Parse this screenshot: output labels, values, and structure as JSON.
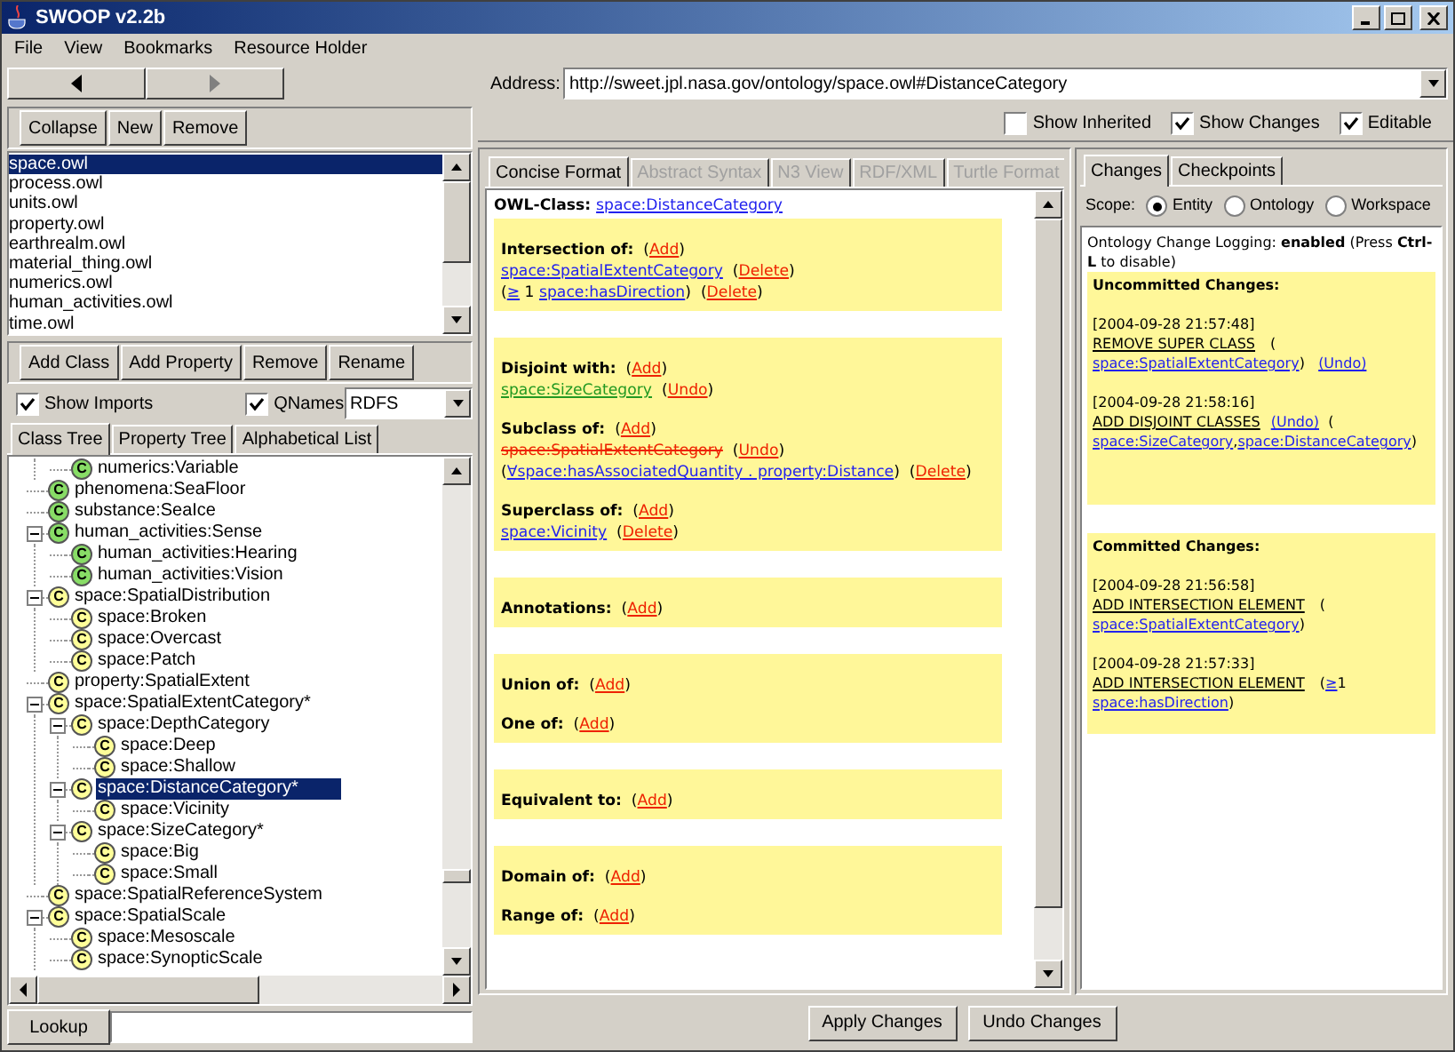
{
  "window": {
    "title": "SWOOP v2.2b"
  },
  "menu": [
    "File",
    "View",
    "Bookmarks",
    "Resource Holder"
  ],
  "address": {
    "label": "Address:",
    "value": "http://sweet.jpl.nasa.gov/ontology/space.owl#DistanceCategory"
  },
  "ontology_toolbar": [
    "Collapse",
    "New",
    "Remove"
  ],
  "ontologies": [
    {
      "name": "space.owl",
      "selected": true
    },
    {
      "name": "process.owl",
      "selected": false
    },
    {
      "name": "units.owl",
      "selected": false
    },
    {
      "name": "property.owl",
      "selected": false
    },
    {
      "name": "earthrealm.owl",
      "selected": false
    },
    {
      "name": "material_thing.owl",
      "selected": false
    },
    {
      "name": "numerics.owl",
      "selected": false
    },
    {
      "name": "human_activities.owl",
      "selected": false
    },
    {
      "name": "time.owl",
      "selected": false
    }
  ],
  "entity_toolbar": [
    "Add Class",
    "Add Property",
    "Remove",
    "Rename"
  ],
  "options": [
    {
      "label": "Show Imports",
      "checked": true
    },
    {
      "label": "QNames",
      "checked": true
    }
  ],
  "syntax_select": {
    "value": "RDFS"
  },
  "tree_tabs": [
    {
      "label": "Class Tree",
      "selected": true
    },
    {
      "label": "Property Tree",
      "selected": false
    },
    {
      "label": "Alphabetical List",
      "selected": false
    }
  ],
  "tree": [
    {
      "expanded": true,
      "children": [
        {
          "label": "numerics:Variable",
          "icon": "C",
          "color": "#88dd66",
          "selected": false
        }
      ]
    },
    {
      "label": "phenomena:SeaFloor",
      "icon": "C",
      "color": "#88dd66",
      "selected": false
    },
    {
      "label": "substance:SeaIce",
      "icon": "C",
      "color": "#88dd66",
      "selected": false
    },
    {
      "label": "human_activities:Sense",
      "icon": "C",
      "color": "#88dd66",
      "selected": false,
      "expanded": true,
      "children": [
        {
          "label": "human_activities:Hearing",
          "icon": "C",
          "color": "#88dd66",
          "selected": false
        },
        {
          "label": "human_activities:Vision",
          "icon": "C",
          "color": "#88dd66",
          "selected": false
        }
      ]
    },
    {
      "label": "space:SpatialDistribution",
      "icon": "C",
      "color": "#ffff99",
      "selected": false,
      "expanded": true,
      "children": [
        {
          "label": "space:Broken",
          "icon": "C",
          "color": "#ffff99",
          "selected": false
        },
        {
          "label": "space:Overcast",
          "icon": "C",
          "color": "#ffff99",
          "selected": false
        },
        {
          "label": "space:Patch",
          "icon": "C",
          "color": "#ffff99",
          "selected": false
        }
      ]
    },
    {
      "label": "property:SpatialExtent",
      "icon": "C",
      "color": "#ffff99",
      "selected": false
    },
    {
      "label": "space:SpatialExtentCategory*",
      "icon": "C",
      "color": "#ffff99",
      "selected": false,
      "expanded": true,
      "children": [
        {
          "label": "space:DepthCategory",
          "icon": "C",
          "color": "#ffff99",
          "selected": false,
          "expanded": true,
          "children": [
            {
              "label": "space:Deep",
              "icon": "C",
              "color": "#ffff99",
              "selected": false
            },
            {
              "label": "space:Shallow",
              "icon": "C",
              "color": "#ffff99",
              "selected": false
            }
          ]
        },
        {
          "label": "space:DistanceCategory*",
          "icon": "C",
          "color": "#ffff99",
          "selected": true,
          "expanded": true,
          "children": [
            {
              "label": "space:Vicinity",
              "icon": "C",
              "color": "#ffff99",
              "selected": false
            }
          ]
        },
        {
          "label": "space:SizeCategory*",
          "icon": "C",
          "color": "#ffff99",
          "selected": false,
          "expanded": true,
          "children": [
            {
              "label": "space:Big",
              "icon": "C",
              "color": "#ffff99",
              "selected": false
            },
            {
              "label": "space:Small",
              "icon": "C",
              "color": "#ffff99",
              "selected": false
            }
          ]
        }
      ]
    },
    {
      "label": "space:SpatialReferenceSystem",
      "icon": "C",
      "color": "#ffff99",
      "selected": false
    },
    {
      "label": "space:SpatialScale",
      "icon": "C",
      "color": "#ffff99",
      "selected": false,
      "expanded": true,
      "children": [
        {
          "label": "space:Mesoscale",
          "icon": "C",
          "color": "#ffff99",
          "selected": false
        },
        {
          "label": "space:SynopticScale",
          "icon": "C",
          "color": "#ffff99",
          "selected": false
        }
      ]
    }
  ],
  "lookup": {
    "button": "Lookup"
  },
  "view_options": [
    {
      "label": "Show Inherited",
      "checked": false
    },
    {
      "label": "Show Changes",
      "checked": true
    },
    {
      "label": "Editable",
      "checked": true
    }
  ],
  "format_tabs": [
    {
      "label": "Concise Format",
      "selected": true,
      "disabled": false
    },
    {
      "label": "Abstract Syntax",
      "selected": false,
      "disabled": true
    },
    {
      "label": "N3 View",
      "selected": false,
      "disabled": true
    },
    {
      "label": "RDF/XML",
      "selected": false,
      "disabled": true
    },
    {
      "label": "Turtle Format",
      "selected": false,
      "disabled": true
    }
  ],
  "concise": {
    "header": [
      {
        "kind": "label",
        "text": "OWL-Class: "
      },
      {
        "kind": "link",
        "text": "space:DistanceCategory"
      }
    ],
    "blocks": [
      {
        "sections": [
          {
            "lines": [
              [
                {
                  "kind": "label",
                  "text": "Intersection of:"
                },
                {
                  "kind": "text",
                  "text": "  ("
                },
                {
                  "kind": "action",
                  "text": "Add"
                },
                {
                  "kind": "text",
                  "text": ")"
                }
              ],
              [
                {
                  "kind": "link",
                  "text": "space:SpatialExtentCategory"
                },
                {
                  "kind": "text",
                  "text": "  ("
                },
                {
                  "kind": "action",
                  "text": "Delete"
                },
                {
                  "kind": "text",
                  "text": ")"
                }
              ],
              [
                {
                  "kind": "text",
                  "text": "("
                },
                {
                  "kind": "link",
                  "text": "≥"
                },
                {
                  "kind": "text",
                  "text": " 1 "
                },
                {
                  "kind": "link",
                  "text": "space:hasDirection"
                },
                {
                  "kind": "text",
                  "text": ")  ("
                },
                {
                  "kind": "action",
                  "text": "Delete"
                },
                {
                  "kind": "text",
                  "text": ")"
                }
              ]
            ]
          }
        ]
      },
      {
        "sections": [
          {
            "lines": [
              [
                {
                  "kind": "label",
                  "text": "Disjoint with:"
                },
                {
                  "kind": "text",
                  "text": "  ("
                },
                {
                  "kind": "action",
                  "text": "Add"
                },
                {
                  "kind": "text",
                  "text": ")"
                }
              ],
              [
                {
                  "kind": "added",
                  "text": "space:SizeCategory"
                },
                {
                  "kind": "text",
                  "text": "  ("
                },
                {
                  "kind": "action",
                  "text": "Undo"
                },
                {
                  "kind": "text",
                  "text": ")"
                }
              ]
            ]
          },
          {
            "lines": [
              [
                {
                  "kind": "label",
                  "text": "Subclass of:"
                },
                {
                  "kind": "text",
                  "text": "  ("
                },
                {
                  "kind": "action",
                  "text": "Add"
                },
                {
                  "kind": "text",
                  "text": ")"
                }
              ],
              [
                {
                  "kind": "removed",
                  "text": "space:SpatialExtentCategory"
                },
                {
                  "kind": "text",
                  "text": "  ("
                },
                {
                  "kind": "action",
                  "text": "Undo"
                },
                {
                  "kind": "text",
                  "text": ")"
                }
              ],
              [
                {
                  "kind": "text",
                  "text": "("
                },
                {
                  "kind": "link",
                  "text": "∀space:hasAssociatedQuantity . property:Distance"
                },
                {
                  "kind": "text",
                  "text": ")  ("
                },
                {
                  "kind": "action",
                  "text": "Delete"
                },
                {
                  "kind": "text",
                  "text": ")"
                }
              ]
            ]
          },
          {
            "lines": [
              [
                {
                  "kind": "label",
                  "text": "Superclass of:"
                },
                {
                  "kind": "text",
                  "text": "  ("
                },
                {
                  "kind": "action",
                  "text": "Add"
                },
                {
                  "kind": "text",
                  "text": ")"
                }
              ],
              [
                {
                  "kind": "link",
                  "text": "space:Vicinity"
                },
                {
                  "kind": "text",
                  "text": "  ("
                },
                {
                  "kind": "action",
                  "text": "Delete"
                },
                {
                  "kind": "text",
                  "text": ")"
                }
              ]
            ]
          }
        ]
      },
      {
        "sections": [
          {
            "lines": [
              [
                {
                  "kind": "label",
                  "text": "Annotations:"
                },
                {
                  "kind": "text",
                  "text": "  ("
                },
                {
                  "kind": "action",
                  "text": "Add"
                },
                {
                  "kind": "text",
                  "text": ")"
                }
              ]
            ]
          }
        ]
      },
      {
        "sections": [
          {
            "lines": [
              [
                {
                  "kind": "label",
                  "text": "Union of:"
                },
                {
                  "kind": "text",
                  "text": "  ("
                },
                {
                  "kind": "action",
                  "text": "Add"
                },
                {
                  "kind": "text",
                  "text": ")"
                }
              ]
            ]
          },
          {
            "lines": [
              [
                {
                  "kind": "label",
                  "text": "One of:"
                },
                {
                  "kind": "text",
                  "text": "  ("
                },
                {
                  "kind": "action",
                  "text": "Add"
                },
                {
                  "kind": "text",
                  "text": ")"
                }
              ]
            ]
          }
        ]
      },
      {
        "sections": [
          {
            "lines": [
              [
                {
                  "kind": "label",
                  "text": "Equivalent to:"
                },
                {
                  "kind": "text",
                  "text": "  ("
                },
                {
                  "kind": "action",
                  "text": "Add"
                },
                {
                  "kind": "text",
                  "text": ")"
                }
              ]
            ]
          }
        ]
      },
      {
        "sections": [
          {
            "lines": [
              [
                {
                  "kind": "label",
                  "text": "Domain of:"
                },
                {
                  "kind": "text",
                  "text": "  ("
                },
                {
                  "kind": "action",
                  "text": "Add"
                },
                {
                  "kind": "text",
                  "text": ")"
                }
              ]
            ]
          },
          {
            "lines": [
              [
                {
                  "kind": "label",
                  "text": "Range of:"
                },
                {
                  "kind": "text",
                  "text": "  ("
                },
                {
                  "kind": "action",
                  "text": "Add"
                },
                {
                  "kind": "text",
                  "text": ")"
                }
              ]
            ]
          }
        ]
      }
    ]
  },
  "actions": [
    "Apply Changes",
    "Undo Changes"
  ],
  "change_tabs": [
    {
      "label": "Changes",
      "selected": true
    },
    {
      "label": "Checkpoints",
      "selected": false
    }
  ],
  "scope": {
    "label": "Scope:",
    "options": [
      {
        "label": "Entity",
        "selected": true
      },
      {
        "label": "Ontology",
        "selected": false
      },
      {
        "label": "Workspace",
        "selected": false
      }
    ]
  },
  "changes": {
    "intro": "Ontology Change Logging: **enabled** (Press **Ctrl-L** to disable)",
    "groups": [
      {
        "title": "Uncommitted Changes:",
        "entries": [
          {
            "time": "[2004-09-28 21:57:48]",
            "segments": [
              {
                "kind": "op",
                "text": "REMOVE SUPER CLASS"
              },
              {
                "kind": "text",
                "text": " ("
              },
              {
                "kind": "link",
                "text": "space:SpatialExtentCategory"
              },
              {
                "kind": "text",
                "text": ")   "
              },
              {
                "kind": "link",
                "text": "(Undo)"
              }
            ]
          },
          {
            "time": "[2004-09-28 21:58:16]",
            "segments": [
              {
                "kind": "op",
                "text": "ADD DISJOINT CLASSES"
              },
              {
                "kind": "link",
                "text": "(Undo)"
              },
              {
                "kind": "text",
                "text": "  ("
              },
              {
                "kind": "link",
                "text": "space:SizeCategory"
              },
              {
                "kind": "text",
                "text": ","
              },
              {
                "kind": "link",
                "text": "space:DistanceCategory"
              },
              {
                "kind": "text",
                "text": ")"
              }
            ]
          }
        ]
      },
      {
        "title": "Committed Changes:",
        "entries": [
          {
            "time": "[2004-09-28 21:56:58]",
            "segments": [
              {
                "kind": "op",
                "text": "ADD INTERSECTION ELEMENT"
              },
              {
                "kind": "text",
                "text": " ("
              },
              {
                "kind": "link",
                "text": "space:SpatialExtentCategory"
              },
              {
                "kind": "text",
                "text": ")"
              }
            ]
          },
          {
            "time": "[2004-09-28 21:57:33]",
            "segments": [
              {
                "kind": "op",
                "text": "ADD INTERSECTION ELEMENT"
              },
              {
                "kind": "text",
                "text": " ("
              },
              {
                "kind": "link",
                "text": "≥"
              },
              {
                "kind": "text",
                "text": "1 "
              },
              {
                "kind": "link",
                "text": "space:hasDirection"
              },
              {
                "kind": "text",
                "text": ")"
              }
            ]
          }
        ]
      }
    ]
  }
}
